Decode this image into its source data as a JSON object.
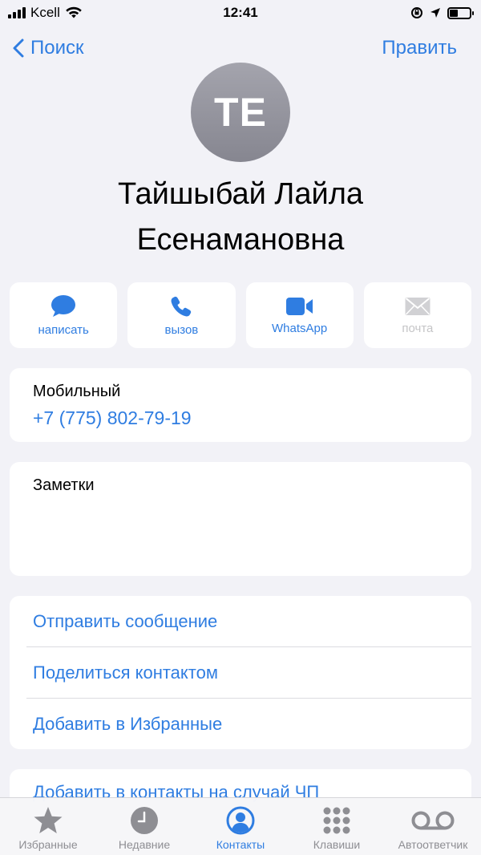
{
  "status_bar": {
    "carrier": "Kcell",
    "time": "12:41"
  },
  "nav": {
    "back_label": "Поиск",
    "edit_label": "Править"
  },
  "contact": {
    "initials": "TE",
    "name_line1": "Тайшыбай Лайла",
    "name_line2": "Есенамановна"
  },
  "actions": [
    {
      "label": "написать",
      "icon": "message-icon",
      "enabled": true
    },
    {
      "label": "вызов",
      "icon": "phone-icon",
      "enabled": true
    },
    {
      "label": "WhatsApp",
      "icon": "video-icon",
      "enabled": true
    },
    {
      "label": "почта",
      "icon": "mail-icon",
      "enabled": false
    }
  ],
  "phone": {
    "label": "Мобильный",
    "number": "+7 (775) 802-79-19"
  },
  "notes": {
    "label": "Заметки"
  },
  "links": [
    "Отправить сообщение",
    "Поделиться контактом",
    "Добавить в Избранные"
  ],
  "emergency": {
    "label": "Добавить в контакты на случай ЧП"
  },
  "tabbar": {
    "items": [
      {
        "label": "Избранные",
        "icon": "star-icon",
        "active": false
      },
      {
        "label": "Недавние",
        "icon": "clock-icon",
        "active": false
      },
      {
        "label": "Контакты",
        "icon": "person-icon",
        "active": true
      },
      {
        "label": "Клавиши",
        "icon": "keypad-icon",
        "active": false
      },
      {
        "label": "Автоответчик",
        "icon": "voicemail-icon",
        "active": false
      }
    ]
  },
  "colors": {
    "accent": "#2f7de1",
    "background": "#f2f2f7",
    "inactive": "#8e8e93",
    "disabled": "#c5c5c7"
  }
}
